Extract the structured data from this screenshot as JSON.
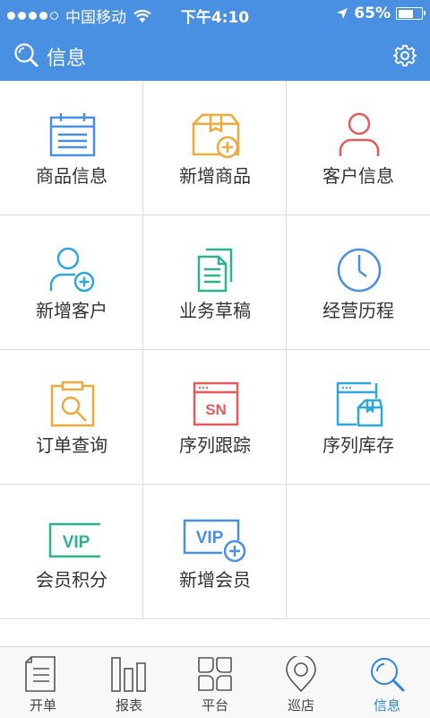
{
  "status": {
    "carrier": "中国移动",
    "time": "下午4:10",
    "battery": "65%",
    "battery_level": 0.65
  },
  "header": {
    "title": "信息"
  },
  "colors": {
    "brand": "#4a90e2",
    "icon_blue": "#4a90e2",
    "icon_orange": "#f0a93b",
    "icon_red": "#e35b5b",
    "icon_teal": "#2bb38f",
    "icon_cyan": "#2ea7de",
    "tab_active": "#2d87d8"
  },
  "grid": {
    "items": [
      {
        "label": "商品信息",
        "icon": "calendar-icon"
      },
      {
        "label": "新增商品",
        "icon": "add-box-icon"
      },
      {
        "label": "客户信息",
        "icon": "person-icon"
      },
      {
        "label": "新增客户",
        "icon": "add-person-icon"
      },
      {
        "label": "业务草稿",
        "icon": "documents-icon"
      },
      {
        "label": "经营历程",
        "icon": "clock-icon"
      },
      {
        "label": "订单查询",
        "icon": "clipboard-search-icon"
      },
      {
        "label": "序列跟踪",
        "icon": "sn-window-icon"
      },
      {
        "label": "序列库存",
        "icon": "window-box-icon"
      },
      {
        "label": "会员积分",
        "icon": "vip-card-icon"
      },
      {
        "label": "新增会员",
        "icon": "vip-add-icon"
      }
    ],
    "sn_text": "SN",
    "vip_text": "VIP"
  },
  "tabs": [
    {
      "label": "开单",
      "icon": "document-icon",
      "active": false
    },
    {
      "label": "报表",
      "icon": "bar-chart-icon",
      "active": false
    },
    {
      "label": "平台",
      "icon": "grid-icon",
      "active": false
    },
    {
      "label": "巡店",
      "icon": "location-pin-icon",
      "active": false
    },
    {
      "label": "信息",
      "icon": "search-icon",
      "active": true
    }
  ]
}
